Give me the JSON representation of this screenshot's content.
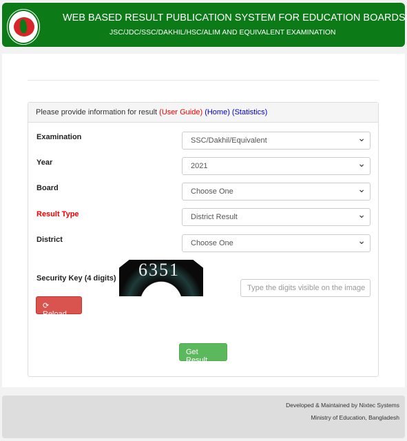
{
  "header": {
    "title": "WEB BASED RESULT PUBLICATION SYSTEM FOR EDUCATION BOARDS",
    "subtitle": "JSC/JDC/SSC/DAKHIL/HSC/ALIM AND EQUIVALENT EXAMINATION",
    "logo_icon": "government-seal"
  },
  "panel": {
    "prompt": "Please provide information for result ",
    "user_guide": "(User Guide)",
    "home": "(Home)",
    "statistics": "(Statistics)"
  },
  "form": {
    "examination": {
      "label": "Examination",
      "value": "SSC/Dakhil/Equivalent"
    },
    "year": {
      "label": "Year",
      "value": "2021"
    },
    "board": {
      "label": "Board",
      "value": "Choose One"
    },
    "result_type": {
      "label": "Result Type",
      "value": "District Result"
    },
    "district": {
      "label": "District",
      "value": "Choose One"
    },
    "security": {
      "label": "Security Key (4 digits)",
      "captcha": "6351",
      "placeholder": "Type the digits visible on the image"
    },
    "reload": "Reload",
    "reload_icon": "refresh-icon",
    "submit": "Get Result"
  },
  "footer": {
    "line1": "Developed & Maintained by Nixtec Systems",
    "line2": "Ministry of Education, Bangladesh"
  },
  "colors": {
    "header": "#0b7a17",
    "danger": "#d9534f",
    "success": "#5cb85c"
  }
}
